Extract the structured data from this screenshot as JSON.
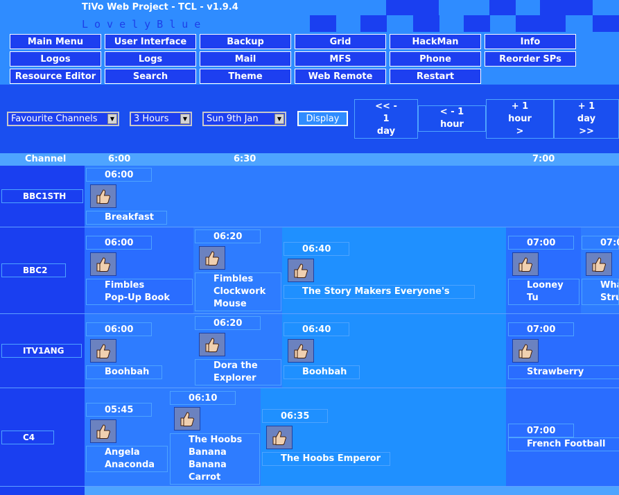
{
  "header": {
    "title": "TiVo Web Project - TCL - v1.9.4",
    "subtitle": "LovelyBlue"
  },
  "menu": [
    "Main Menu",
    "User Interface",
    "Backup",
    "Grid",
    "HackMan",
    "Info",
    "Logos",
    "Logs",
    "Mail",
    "MFS",
    "Phone",
    "Reorder SPs",
    "Resource Editor",
    "Search",
    "Theme",
    "Web Remote",
    "Restart"
  ],
  "controls": {
    "channel_group": "Favourite Channels",
    "duration": "3 Hours",
    "date": "Sun 9th Jan",
    "display_label": "Display"
  },
  "nav": {
    "back_day": [
      "<< -",
      "1",
      "day"
    ],
    "back_hour": [
      "< - 1",
      "hour"
    ],
    "fwd_hour": [
      "+ 1",
      "hour",
      ">"
    ],
    "fwd_day": [
      "+ 1",
      "day",
      ">>"
    ]
  },
  "timebar": {
    "channel_label": "Channel",
    "times": [
      "6:00",
      "6:30",
      "7:00"
    ]
  },
  "icons": {
    "programme": "thumbs-up-icon"
  },
  "channels": [
    {
      "name": "BBC1STH",
      "programmes": [
        {
          "time": "06:00",
          "title": "Breakfast"
        }
      ]
    },
    {
      "name": "BBC2",
      "programmes": [
        {
          "time": "06:00",
          "title": "Fimbles\nPop-Up Book"
        },
        {
          "time": "06:20",
          "title": "Fimbles\nClockwork\nMouse"
        },
        {
          "time": "06:40",
          "title": "The Story Makers Everyone's Diffe"
        },
        {
          "time": "07:00",
          "title": "Looney\nTu"
        },
        {
          "time": "07:0",
          "title": "Wha\nStru"
        }
      ]
    },
    {
      "name": "ITV1ANG",
      "programmes": [
        {
          "time": "06:00",
          "title": "Boohbah"
        },
        {
          "time": "06:20",
          "title": "Dora the\nExplorer"
        },
        {
          "time": "06:40",
          "title": "Boohbah"
        },
        {
          "time": "07:00",
          "title": "Strawberry Shortcak"
        }
      ]
    },
    {
      "name": "C4",
      "programmes": [
        {
          "time": "05:45",
          "title": "Angela\nAnaconda"
        },
        {
          "time": "06:10",
          "title": "The Hoobs\nBanana\nBanana\nCarrot"
        },
        {
          "time": "06:35",
          "title": "The Hoobs Emperor"
        },
        {
          "time": "07:00",
          "title": "French Football"
        }
      ]
    }
  ]
}
